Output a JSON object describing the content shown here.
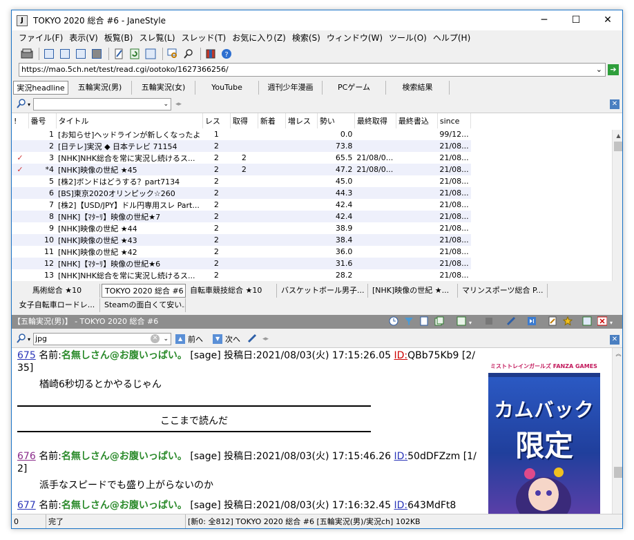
{
  "window": {
    "title": "TOKYO 2020 総合 #6 - JaneStyle",
    "app_icon": "J",
    "minimize_icon": "─",
    "maximize_icon": "☐",
    "close_icon": "✕"
  },
  "menu": [
    "ファイル(F)",
    "表示(V)",
    "板覧(B)",
    "スレ覧(L)",
    "スレッド(T)",
    "お気に入り(Z)",
    "検索(S)",
    "ウィンドウ(W)",
    "ツール(O)",
    "ヘルプ(H)"
  ],
  "address": {
    "url": "https://mao.5ch.net/test/read.cgi/ootoko/1627366256/",
    "dropdown_icon": "⌄",
    "go_icon": "➔"
  },
  "board_tabs": [
    "実況headline",
    "五輪実況(男)",
    "五輪実況(女)",
    "YouTube",
    "週刊少年漫画",
    "PCゲーム",
    "検索結果"
  ],
  "thread_list": {
    "columns": [
      "!",
      "番号",
      "タイトル",
      "レス",
      "取得",
      "新着",
      "増レス",
      "勢い",
      "最終取得",
      "最終書込",
      "since"
    ],
    "rows": [
      {
        "mark": "",
        "num": "1",
        "title": "[お知らせ]ヘッドラインが新しくなったよ",
        "res": "1",
        "got": "",
        "new": "",
        "inc": "",
        "speed": "0.0",
        "last_get": "",
        "last_post": "",
        "since": "99/12..."
      },
      {
        "mark": "",
        "num": "2",
        "title": "[日テレ]実況 ◆ 日本テレビ 71154",
        "res": "2",
        "got": "",
        "new": "",
        "inc": "",
        "speed": "73.8",
        "last_get": "",
        "last_post": "",
        "since": "21/08..."
      },
      {
        "mark": "✓",
        "num": "3",
        "title": "[NHK]NHK総合を常に実況し続けるス...",
        "res": "2",
        "got": "2",
        "new": "",
        "inc": "",
        "speed": "65.5",
        "last_get": "21/08/0...",
        "last_post": "",
        "since": "21/08..."
      },
      {
        "mark": "✓",
        "num": "*4",
        "title": "[NHK]映像の世紀 ★45",
        "res": "2",
        "got": "2",
        "new": "",
        "inc": "",
        "speed": "47.2",
        "last_get": "21/08/0...",
        "last_post": "",
        "since": "21/08..."
      },
      {
        "mark": "",
        "num": "5",
        "title": "[株2]ボンドはどうする？part7134",
        "res": "2",
        "got": "",
        "new": "",
        "inc": "",
        "speed": "45.0",
        "last_get": "",
        "last_post": "",
        "since": "21/08..."
      },
      {
        "mark": "",
        "num": "6",
        "title": "[BS]東京2020オリンピック☆260",
        "res": "2",
        "got": "",
        "new": "",
        "inc": "",
        "speed": "44.3",
        "last_get": "",
        "last_post": "",
        "since": "21/08..."
      },
      {
        "mark": "",
        "num": "7",
        "title": "[株2]【USD/JPY】ドル円専用スレ Part...",
        "res": "2",
        "got": "",
        "new": "",
        "inc": "",
        "speed": "42.4",
        "last_get": "",
        "last_post": "",
        "since": "21/08..."
      },
      {
        "mark": "",
        "num": "8",
        "title": "[NHK]【ﾏﾀｰﾘ】映像の世紀★7",
        "res": "2",
        "got": "",
        "new": "",
        "inc": "",
        "speed": "42.4",
        "last_get": "",
        "last_post": "",
        "since": "21/08..."
      },
      {
        "mark": "",
        "num": "9",
        "title": "[NHK]映像の世紀 ★44",
        "res": "2",
        "got": "",
        "new": "",
        "inc": "",
        "speed": "38.9",
        "last_get": "",
        "last_post": "",
        "since": "21/08..."
      },
      {
        "mark": "",
        "num": "10",
        "title": "[NHK]映像の世紀 ★43",
        "res": "2",
        "got": "",
        "new": "",
        "inc": "",
        "speed": "38.4",
        "last_get": "",
        "last_post": "",
        "since": "21/08..."
      },
      {
        "mark": "",
        "num": "11",
        "title": "[NHK]映像の世紀 ★42",
        "res": "2",
        "got": "",
        "new": "",
        "inc": "",
        "speed": "36.0",
        "last_get": "",
        "last_post": "",
        "since": "21/08..."
      },
      {
        "mark": "",
        "num": "12",
        "title": "[NHK]【ﾏﾀｰﾘ】映像の世紀★6",
        "res": "2",
        "got": "",
        "new": "",
        "inc": "",
        "speed": "31.6",
        "last_get": "",
        "last_post": "",
        "since": "21/08..."
      },
      {
        "mark": "",
        "num": "13",
        "title": "[NHK]NHK総合を常に実況し続けるス...",
        "res": "2",
        "got": "",
        "new": "",
        "inc": "",
        "speed": "28.2",
        "last_get": "",
        "last_post": "",
        "since": "21/08..."
      }
    ]
  },
  "thread_tabs": [
    "馬術総合 ★10",
    "TOKYO 2020 総合 #6",
    "自転車競技総合 ★10",
    "バスケットボール男子...",
    "[NHK]映像の世紀 ★...",
    "マリンスポーツ総合 P...",
    "女子自転車ロードレ...",
    "Steamの面白くて安い..."
  ],
  "view": {
    "title": "【五輪実況(男)】 - TOKYO 2020 総合 #6",
    "search_value": "jpg",
    "prev_label": "前へ",
    "next_label": "次へ",
    "posts": [
      {
        "num": "675",
        "name": "名無しさん@お腹いっぱい。",
        "mail": "[sage]",
        "date": "投稿日:2021/08/03(火) 17:15:26.05",
        "id_label": "ID:",
        "id": "QBb75Kb9",
        "count": "[2/",
        "count2": "35]",
        "message": "楢崎6秒切るとかやるじゃん"
      },
      {
        "num": "676",
        "name": "名無しさん@お腹いっぱい。",
        "mail": "[sage]",
        "date": "投稿日:2021/08/03(火) 17:15:46.26",
        "id_label": "ID:",
        "id": "50dDFZzm",
        "count": "[1/",
        "count2": "2]",
        "message": "派手なスピードでも盛り上がらないのか"
      },
      {
        "num": "677",
        "name": "名無しさん@お腹いっぱい。",
        "mail": "[sage]",
        "date": "投稿日:2021/08/03(火) 17:16:32.45",
        "id_label": "ID:",
        "id": "643MdFt8",
        "count": "",
        "count2": "",
        "message": ""
      }
    ],
    "read_marker": "ここまで読んだ",
    "ad": {
      "top_text": "ミストトレインガールズ FANZA GAMES",
      "line1": "カムバック",
      "line2": "限定"
    }
  },
  "status": {
    "count": "0",
    "state": "完了",
    "info": "[新0: 全812] TOKYO 2020 総合 #6  [五輪実況(男)/実況ch]  102KB"
  },
  "colors": {
    "accent": "#1a73c7",
    "name_green": "#2a8a2a",
    "link_blue": "#2a35b8",
    "id_red": "#c00000",
    "check_red": "#d03030",
    "view_title_bg": "#8e8e8e"
  },
  "icons": [
    "search-icon",
    "dropdown-icon",
    "close-icon",
    "check-icon",
    "up-arrow-icon",
    "down-arrow-icon",
    "pen-icon",
    "clear-icon"
  ]
}
